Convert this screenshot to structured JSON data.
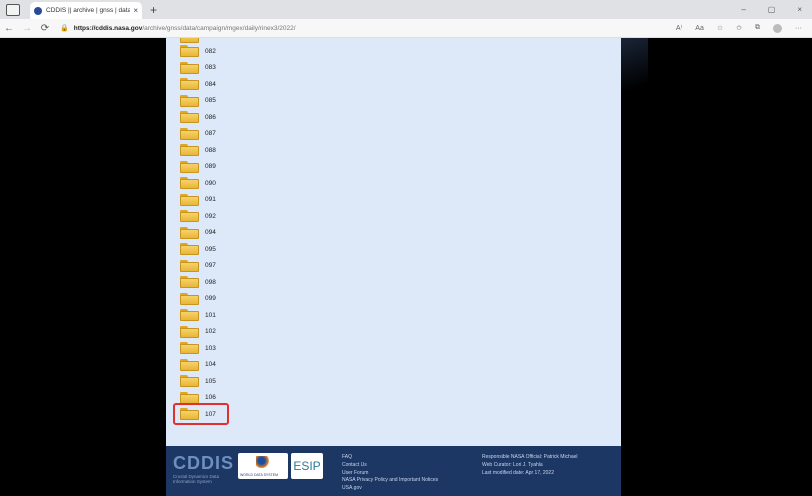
{
  "browser": {
    "tab_title": "CDDIS || archive | gnss | data | ca",
    "tab_close": "×",
    "new_tab": "+",
    "url_host": "https://cddis.nasa.gov",
    "url_path": "/archive/gnss/data/campaign/mgex/daily/rinex3/2022/",
    "controls": {
      "minimize": "–",
      "maximize": "▢",
      "close": "×"
    },
    "nav": {
      "back": "←",
      "forward": "→",
      "refresh": "⟳",
      "lock": "🔒"
    },
    "toolbar": {
      "read_aloud": "A⁾",
      "reading_view": "Aa",
      "favorite": "☆",
      "favorites": "✩",
      "collections": "⧉",
      "more": "···"
    }
  },
  "directory": {
    "items": [
      "082",
      "083",
      "084",
      "085",
      "086",
      "087",
      "088",
      "089",
      "090",
      "091",
      "092",
      "094",
      "095",
      "097",
      "098",
      "099",
      "101",
      "102",
      "103",
      "104",
      "105",
      "106",
      "107"
    ],
    "highlighted": "107"
  },
  "footer": {
    "logo_text": "CDDIS",
    "logo_subtitle_1": "Crustal Dynamics Data",
    "logo_subtitle_2": "Information System",
    "wds_label": "WORLD DATA SYSTEM",
    "esip_label": "ESIP",
    "links": [
      "FAQ",
      "Contact Us",
      "User Forum",
      "NASA Privacy Policy and Important Notices",
      "USA.gov"
    ],
    "responsible": "Responsible NASA Official: Patrick Michael",
    "curator": "Web Curator: Lori J. Tyahla",
    "modified": "Last modified date: Apr 17, 2022"
  }
}
